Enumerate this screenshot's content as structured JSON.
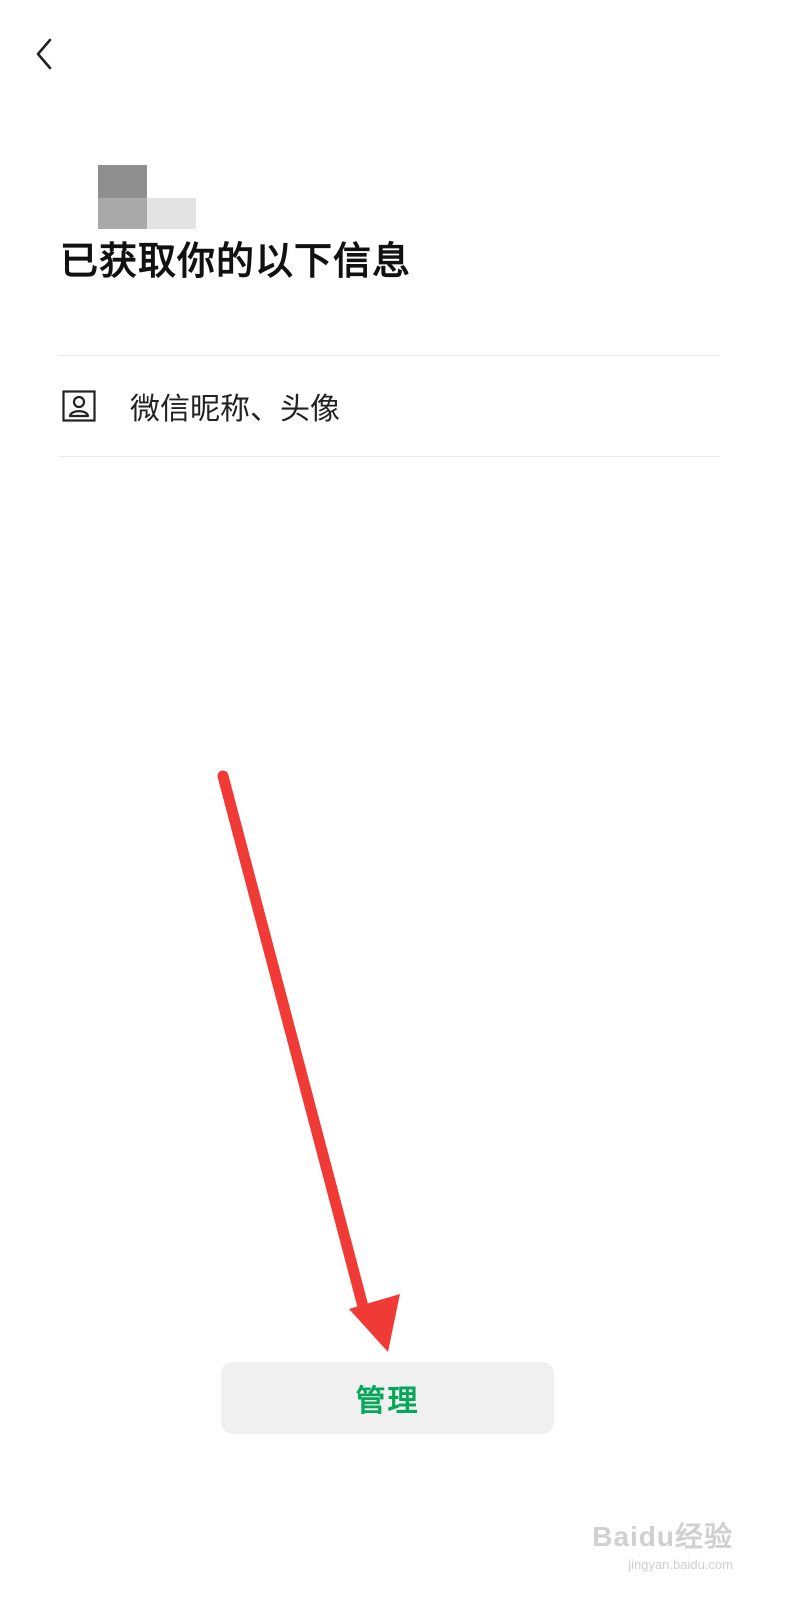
{
  "header": {
    "back_icon": "chevron-left-icon"
  },
  "app": {
    "logo": "blurred-app-logo"
  },
  "page": {
    "title": "已获取你的以下信息"
  },
  "permissions": [
    {
      "icon": "profile-card-icon",
      "label": "微信昵称、头像"
    }
  ],
  "footer": {
    "manage_label": "管理"
  },
  "annotation": {
    "arrow_color": "#f03a35"
  },
  "watermark": {
    "brand": "Baidu经验",
    "url": "jingyan.baidu.com"
  },
  "colors": {
    "accent": "#07a75b",
    "button_bg": "#f0f0f0"
  }
}
